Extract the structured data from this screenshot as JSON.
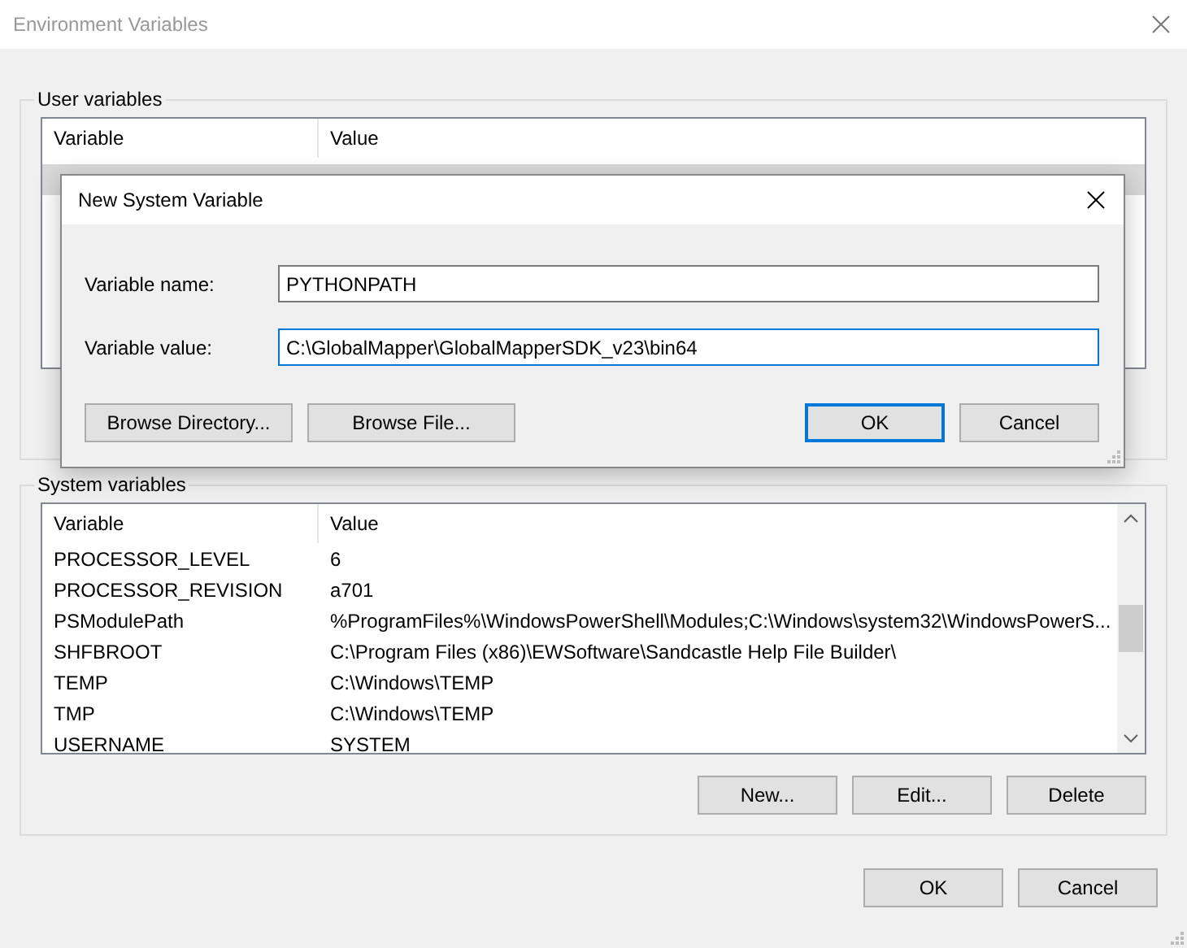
{
  "window": {
    "title": "Environment Variables"
  },
  "user_variables": {
    "title": "User variables",
    "columns": [
      "Variable",
      "Value"
    ],
    "rows": [
      {
        "selected": true
      }
    ]
  },
  "system_variables": {
    "title": "System variables",
    "columns": [
      "Variable",
      "Value"
    ],
    "rows": [
      {
        "variable": "PROCESSOR_LEVEL",
        "value": "6",
        "selected": false
      },
      {
        "variable": "PROCESSOR_REVISION",
        "value": "a701",
        "selected": false
      },
      {
        "variable": "PSModulePath",
        "value": "%ProgramFiles%\\WindowsPowerShell\\Modules;C:\\Windows\\system32\\WindowsPowerS...",
        "selected": false
      },
      {
        "variable": "SHFBROOT",
        "value": "C:\\Program Files (x86)\\EWSoftware\\Sandcastle Help File Builder\\",
        "selected": false
      },
      {
        "variable": "TEMP",
        "value": "C:\\Windows\\TEMP",
        "selected": false
      },
      {
        "variable": "TMP",
        "value": "C:\\Windows\\TEMP",
        "selected": false
      },
      {
        "variable": "USERNAME",
        "value": "SYSTEM",
        "selected": false
      }
    ],
    "buttons": [
      "New...",
      "Edit...",
      "Delete"
    ]
  },
  "buttons": [
    {
      "label": "OK",
      "default": false
    },
    {
      "label": "Cancel",
      "default": false
    }
  ],
  "dialog": {
    "title": "New System Variable",
    "fields": [
      {
        "label": "Variable name:",
        "value": "PYTHONPATH",
        "focused": false
      },
      {
        "label": "Variable value:",
        "value": "C:\\GlobalMapper\\GlobalMapperSDK_v23\\bin64",
        "focused": true
      }
    ],
    "browse_buttons": [
      "Browse Directory...",
      "Browse File..."
    ],
    "buttons": [
      {
        "label": "OK",
        "default": true
      },
      {
        "label": "Cancel",
        "default": false
      }
    ]
  }
}
